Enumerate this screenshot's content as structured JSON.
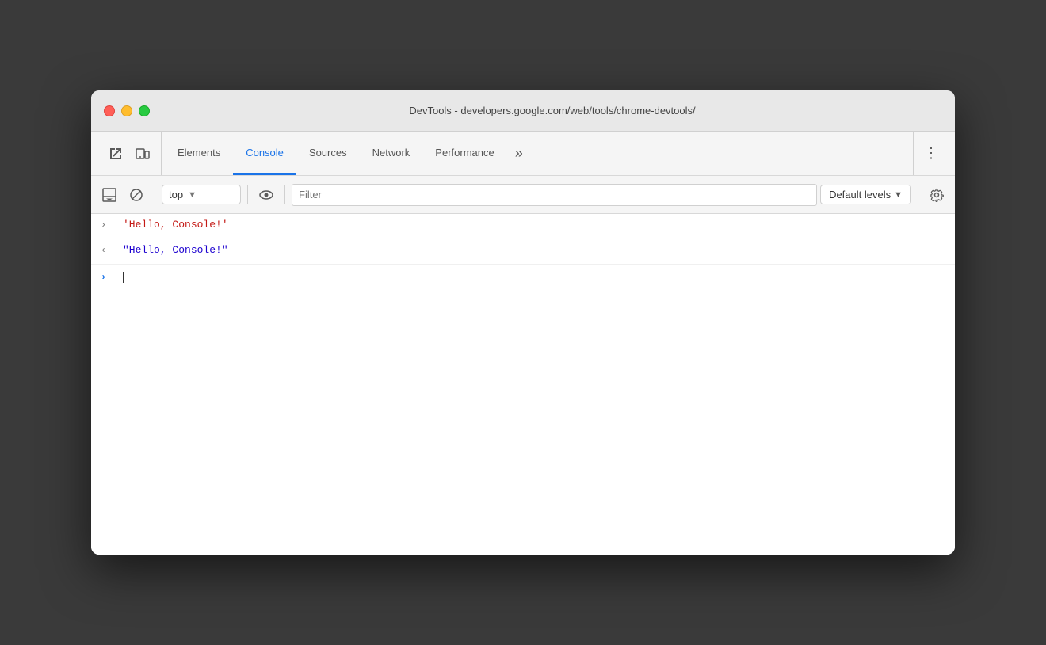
{
  "window": {
    "title": "DevTools - developers.google.com/web/tools/chrome-devtools/"
  },
  "tabs": {
    "items": [
      {
        "id": "elements",
        "label": "Elements",
        "active": false
      },
      {
        "id": "console",
        "label": "Console",
        "active": true
      },
      {
        "id": "sources",
        "label": "Sources",
        "active": false
      },
      {
        "id": "network",
        "label": "Network",
        "active": false
      },
      {
        "id": "performance",
        "label": "Performance",
        "active": false
      }
    ],
    "more_label": "»"
  },
  "console_toolbar": {
    "context_value": "top",
    "context_arrow": "▼",
    "filter_placeholder": "Filter",
    "levels_label": "Default levels",
    "levels_arrow": "▼"
  },
  "console_output": {
    "line1": {
      "arrow": "›",
      "text": "'Hello, Console!'"
    },
    "line2": {
      "arrow": "‹",
      "text": "\"Hello, Console!\""
    }
  }
}
